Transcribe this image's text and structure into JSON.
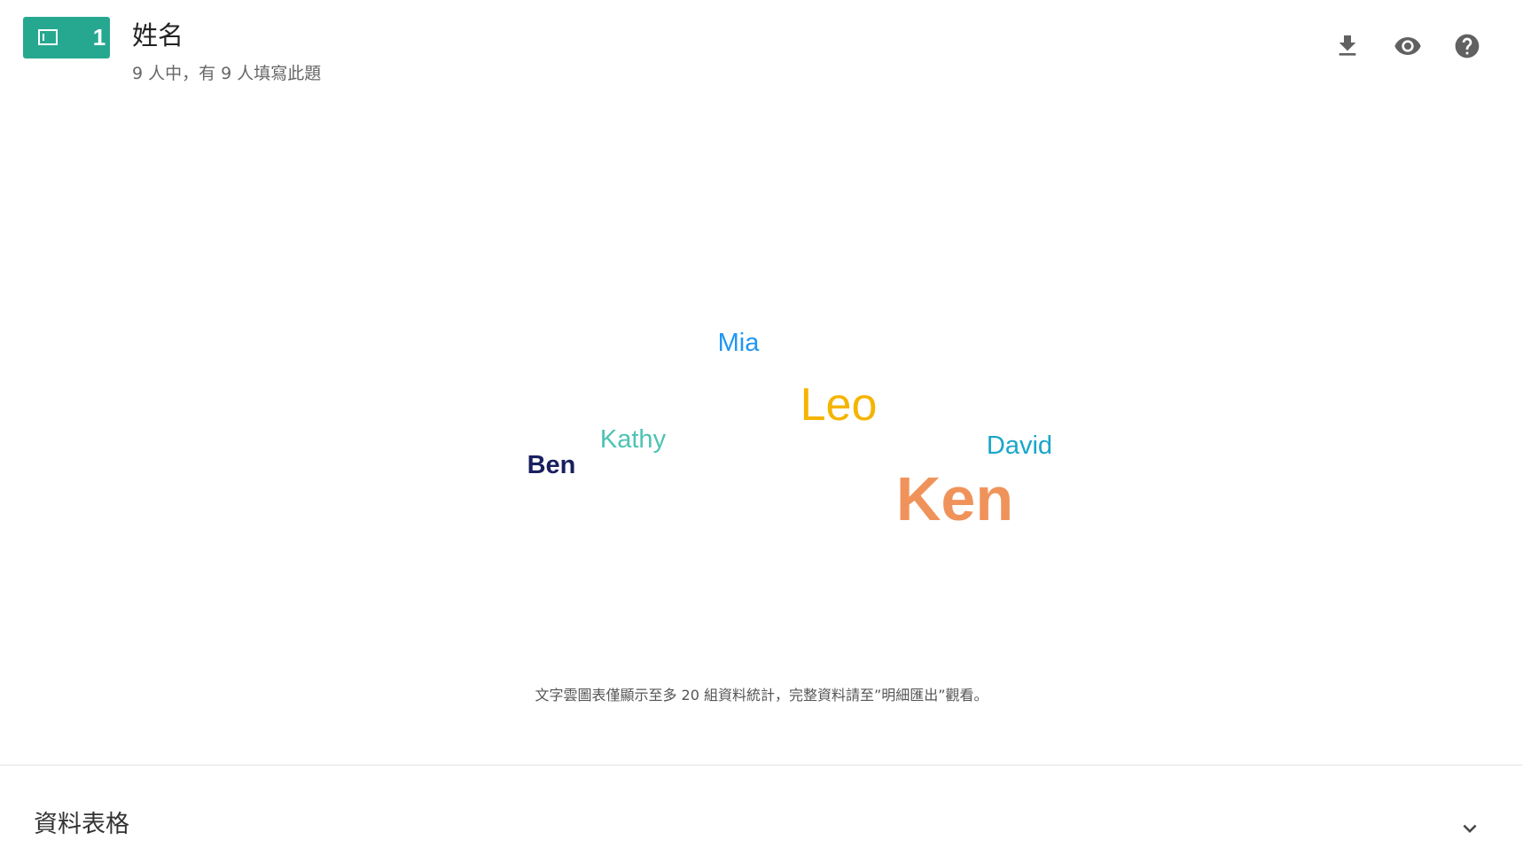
{
  "question": {
    "number": "1",
    "type_icon": "short-answer-icon",
    "title": "姓名",
    "subtitle": "9 人中，有 9 人填寫此題"
  },
  "toolbar": {
    "download_icon": "download-icon",
    "preview_icon": "eye-icon",
    "help_icon": "help-icon"
  },
  "chart_data": {
    "type": "wordcloud",
    "words": [
      {
        "text": "Mia",
        "color": "#2196f3",
        "weight": 2
      },
      {
        "text": "Leo",
        "color": "#f5b400",
        "weight": 3
      },
      {
        "text": "Kathy",
        "color": "#4dc3b4",
        "weight": 2
      },
      {
        "text": "David",
        "color": "#1aa6c9",
        "weight": 2
      },
      {
        "text": "Ben",
        "color": "#1a1f5e",
        "weight": 2
      },
      {
        "text": "Ken",
        "color": "#f0935a",
        "weight": 4
      }
    ]
  },
  "cloud_note": "文字雲圖表僅顯示至多 20 組資料統計，完整資料請至”明細匯出”觀看。",
  "data_table": {
    "title": "資料表格",
    "toggle_icon": "chevron-down-icon"
  },
  "colors": {
    "badge": "#26a890",
    "divider": "#e3e3e3",
    "icon": "#616161"
  }
}
